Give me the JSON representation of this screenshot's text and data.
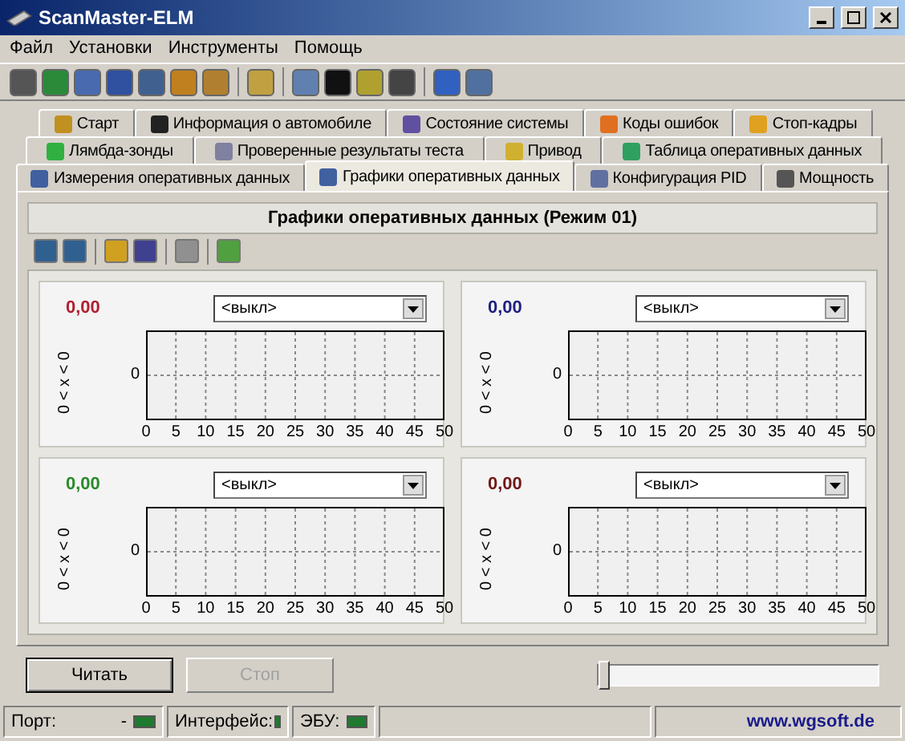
{
  "window": {
    "title": "ScanMaster-ELM"
  },
  "menu": [
    "Файл",
    "Установки",
    "Инструменты",
    "Помощь"
  ],
  "tab_rows": [
    [
      {
        "label": "Старт",
        "selected": false
      },
      {
        "label": "Информация о автомобиле",
        "selected": false
      },
      {
        "label": "Состояние системы",
        "selected": false
      },
      {
        "label": "Коды ошибок",
        "selected": false
      },
      {
        "label": "Стоп-кадры",
        "selected": false
      }
    ],
    [
      {
        "label": "Лямбда-зонды",
        "selected": false
      },
      {
        "label": "Проверенные результаты теста",
        "selected": false
      },
      {
        "label": "Привод",
        "selected": false
      },
      {
        "label": "Таблица оперативных данных",
        "selected": false
      }
    ],
    [
      {
        "label": "Измерения оперативных данных",
        "selected": false
      },
      {
        "label": "Графики оперативных данных",
        "selected": true
      },
      {
        "label": "Конфигурация PID",
        "selected": false
      },
      {
        "label": "Мощность",
        "selected": false
      }
    ]
  ],
  "panel": {
    "title": "Графики оперативных данных (Режим 01)"
  },
  "graphs": [
    {
      "value": "0,00",
      "color": "#b02030",
      "select": "<выкл>",
      "range_label": "0 < x < 0",
      "y_label": "0",
      "x_labels": [
        "0",
        "5",
        "10",
        "15",
        "20",
        "25",
        "30",
        "35",
        "40",
        "45",
        "50"
      ]
    },
    {
      "value": "0,00",
      "color": "#202080",
      "select": "<выкл>",
      "range_label": "0 < x < 0",
      "y_label": "0",
      "x_labels": [
        "0",
        "5",
        "10",
        "15",
        "20",
        "25",
        "30",
        "35",
        "40",
        "45",
        "50"
      ]
    },
    {
      "value": "0,00",
      "color": "#2a8a2a",
      "select": "<выкл>",
      "range_label": "0 < x < 0",
      "y_label": "0",
      "x_labels": [
        "0",
        "5",
        "10",
        "15",
        "20",
        "25",
        "30",
        "35",
        "40",
        "45",
        "50"
      ]
    },
    {
      "value": "0,00",
      "color": "#701818",
      "select": "<выкл>",
      "range_label": "0 < x < 0",
      "y_label": "0",
      "x_labels": [
        "0",
        "5",
        "10",
        "15",
        "20",
        "25",
        "30",
        "35",
        "40",
        "45",
        "50"
      ]
    }
  ],
  "buttons": [
    {
      "label": "Читать",
      "disabled": false
    },
    {
      "label": "Стоп",
      "disabled": true
    }
  ],
  "slider": {
    "level": 0
  },
  "status_bar": {
    "port_label": "Порт:",
    "port_value": "-",
    "port_on": true,
    "interface_label": "Интерфейс:",
    "interface_on": true,
    "ecu_label": "ЭБУ:",
    "ecu_on": true,
    "link": "www.wgsoft.de"
  }
}
